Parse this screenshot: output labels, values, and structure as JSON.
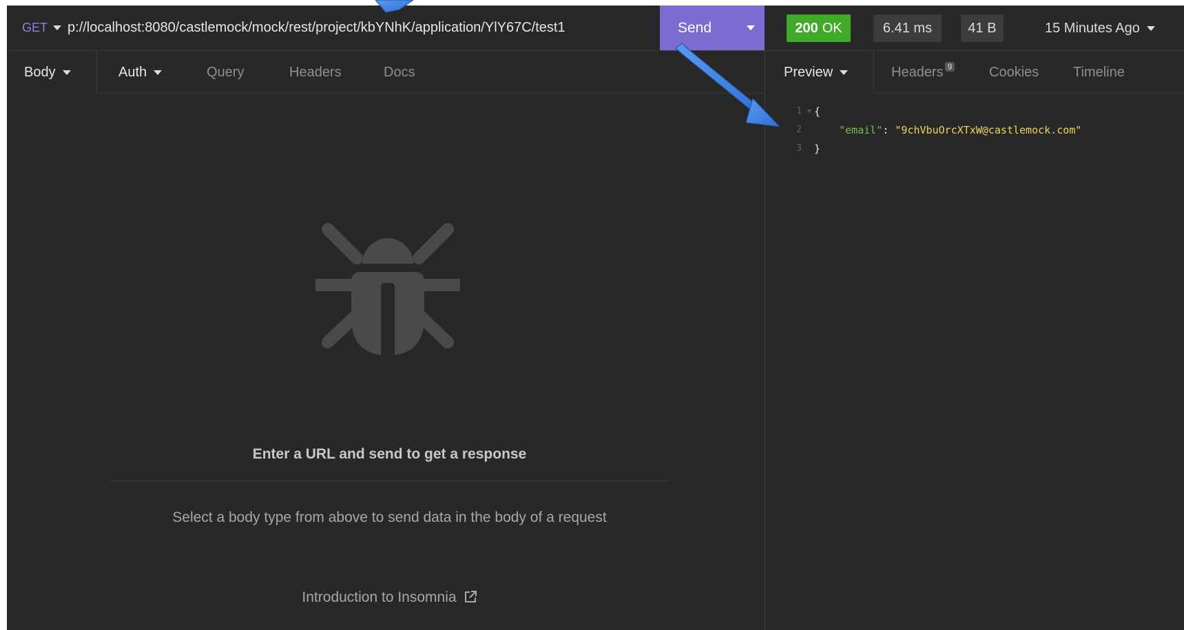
{
  "request": {
    "method": "GET",
    "url": "p://localhost:8080/castlemock/mock/rest/project/kbYNhK/application/YlY67C/test1",
    "send_label": "Send"
  },
  "response_meta": {
    "status_code": "200",
    "status_text": "OK",
    "time": "6.41 ms",
    "size": "41 B",
    "ago": "15 Minutes Ago"
  },
  "request_tabs": {
    "body": "Body",
    "auth": "Auth",
    "query": "Query",
    "headers": "Headers",
    "docs": "Docs"
  },
  "empty_state": {
    "title": "Enter a URL and send to get a response",
    "subtitle": "Select a body type from above to send data in the body of a request",
    "link": "Introduction to Insomnia"
  },
  "response_tabs": {
    "preview": "Preview",
    "headers": "Headers",
    "headers_count": "9",
    "cookies": "Cookies",
    "timeline": "Timeline"
  },
  "response_body": {
    "line_numbers": [
      "1",
      "2",
      "3"
    ],
    "open_brace": "{",
    "key": "\"email\"",
    "colon": ": ",
    "value": "\"9chVbuOrcXTxW@castlemock.com\"",
    "close_brace": "}"
  },
  "colors": {
    "background": "#282828",
    "send_button": "#7d6bd1",
    "status_ok": "#3fa928",
    "method": "#8a82e0",
    "json_key": "#79c04b",
    "json_string": "#f0d35a",
    "annotation_arrow": "#3a7de0"
  },
  "icons": {
    "empty_state": "bug-icon",
    "link": "external-link-icon",
    "dropdown": "caret-down-icon"
  }
}
